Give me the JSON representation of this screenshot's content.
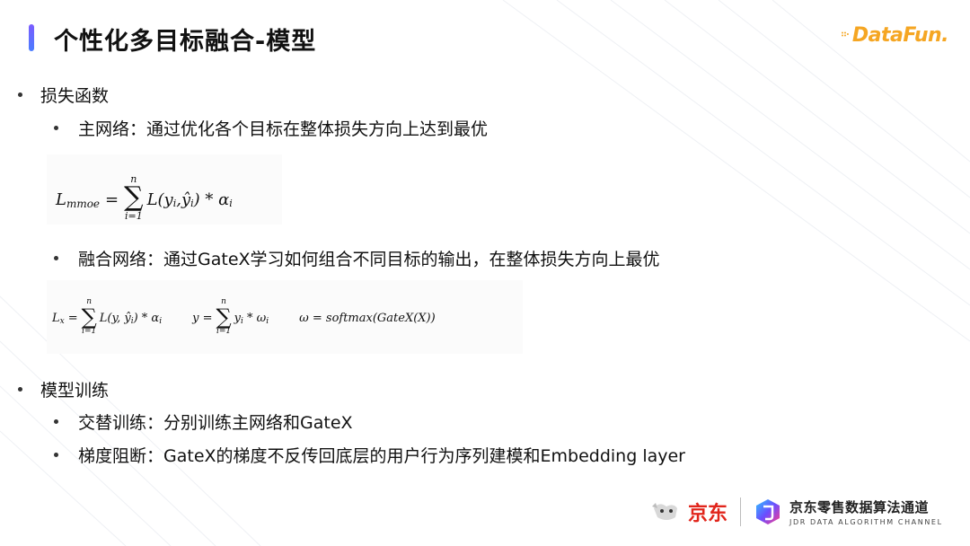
{
  "slide": {
    "title": "个性化多目标融合-模型",
    "brand": "DataFun."
  },
  "content": {
    "section1": {
      "heading": "损失函数",
      "item1": "主网络：通过优化各个目标在整体损失方向上达到最优",
      "item2": "融合网络：通过GateX学习如何组合不同目标的输出，在整体损失方向上最优"
    },
    "section2": {
      "heading": "模型训练",
      "item1": "交替训练：分别训练主网络和GateX",
      "item2": "梯度阻断：GateX的梯度不反传回底层的用户行为序列建模和Embedding layer"
    }
  },
  "formulas": {
    "f1": {
      "lhs": "L",
      "lhs_sub": "mmoe",
      "sigma_top": "n",
      "sigma_bot": "i=1",
      "body": "L(y",
      "body2": ",ŷ",
      "body3": ") * α"
    },
    "f2": {
      "a_lhs": "L",
      "a_sub": "x",
      "a_top": "n",
      "a_bot": "i=1",
      "a_body": "L(y, ŷ",
      "a_body2": ") * α",
      "b_lhs": "y =",
      "b_top": "n",
      "b_bot": "i=1",
      "b_body": "y",
      "b_body2": " * ω",
      "c_text": "ω = softmax(GateX(X))"
    }
  },
  "footer": {
    "jd_label": "京东",
    "channel_cn": "京东零售数据算法通道",
    "channel_en": "JDR DATA ALGORITHM CHANNEL"
  },
  "colors": {
    "accent_bar": "#6a6cff",
    "brand": "#f5a623",
    "jd_red": "#e1251b"
  }
}
